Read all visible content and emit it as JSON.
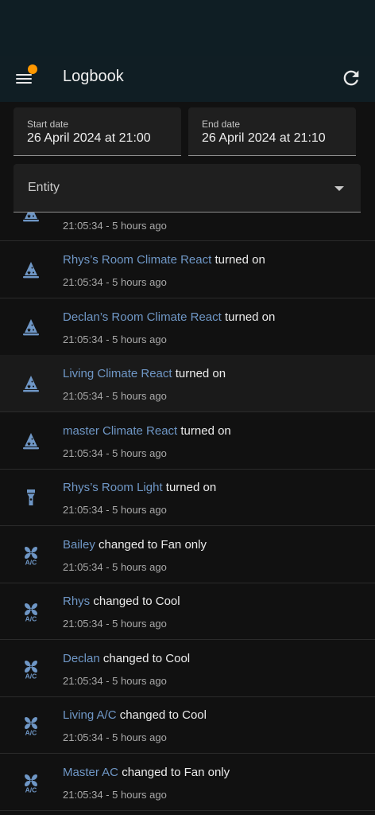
{
  "header": {
    "title": "Logbook"
  },
  "filters": {
    "start": {
      "label": "Start date",
      "value": "26 April 2024 at 21:00"
    },
    "end": {
      "label": "End date",
      "value": "26 April 2024 at 21:10"
    },
    "entity": {
      "label": "Entity"
    }
  },
  "partial_entry": {
    "icon": "wizard-hat-icon",
    "time": "21:05:34 - 5 hours ago"
  },
  "entries": [
    {
      "icon": "wizard-hat-icon",
      "name": "Rhys’s Room Climate React",
      "action": "turned on",
      "time": "21:05:34 - 5 hours ago"
    },
    {
      "icon": "wizard-hat-icon",
      "name": "Declan’s Room Climate React",
      "action": "turned on",
      "time": "21:05:34 - 5 hours ago"
    },
    {
      "icon": "wizard-hat-icon",
      "name": "Living Climate React",
      "action": "turned on",
      "time": "21:05:34 - 5 hours ago"
    },
    {
      "icon": "wizard-hat-icon",
      "name": "master Climate React",
      "action": "turned on",
      "time": "21:05:34 - 5 hours ago"
    },
    {
      "icon": "flashlight-icon",
      "name": "Rhys’s Room Light",
      "action": "turned on",
      "time": "21:05:34 - 5 hours ago"
    },
    {
      "icon": "air-conditioner-icon",
      "name": "Bailey",
      "action": "changed to Fan only",
      "time": "21:05:34 - 5 hours ago"
    },
    {
      "icon": "air-conditioner-icon",
      "name": "Rhys",
      "action": "changed to Cool",
      "time": "21:05:34 - 5 hours ago"
    },
    {
      "icon": "air-conditioner-icon",
      "name": "Declan",
      "action": "changed to Cool",
      "time": "21:05:34 - 5 hours ago"
    },
    {
      "icon": "air-conditioner-icon",
      "name": "Living A/C",
      "action": "changed to Cool",
      "time": "21:05:34 - 5 hours ago"
    },
    {
      "icon": "air-conditioner-icon",
      "name": "Master AC",
      "action": "changed to Fan only",
      "time": "21:05:34 - 5 hours ago"
    }
  ],
  "colors": {
    "accent": "#6f97c6",
    "badge": "#ff9800",
    "appbar": "#101e24",
    "background": "#111111"
  }
}
